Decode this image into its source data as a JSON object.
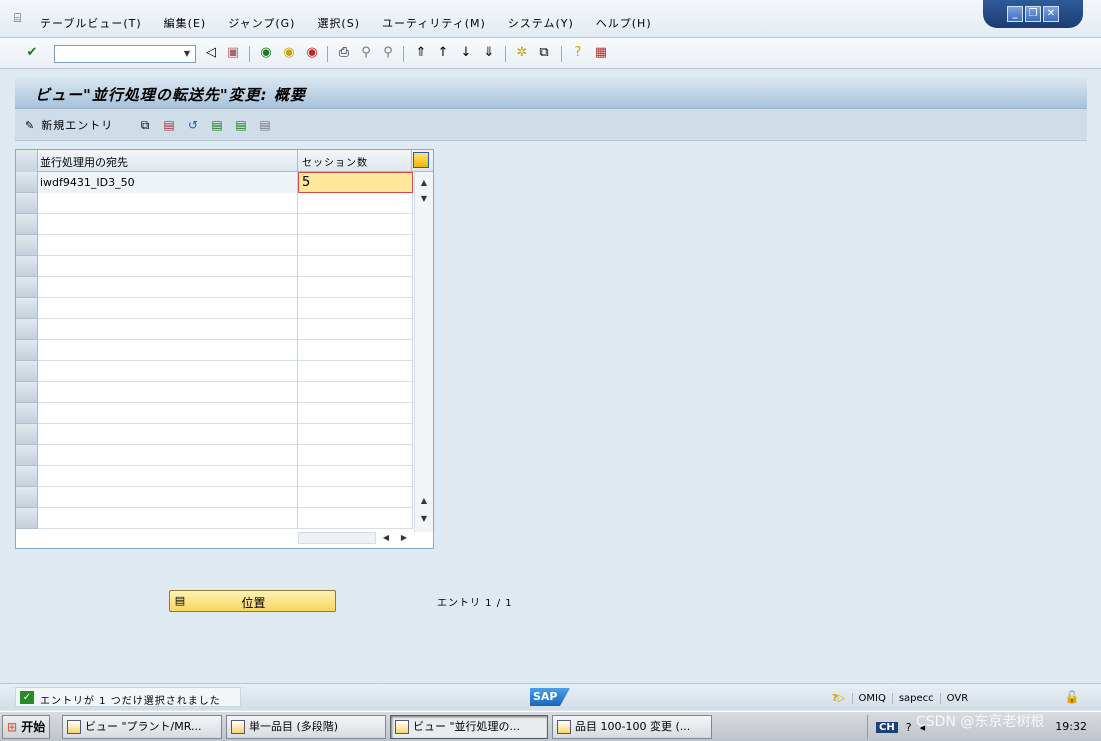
{
  "menubar": {
    "items": [
      "テーブルビュー(T)",
      "編集(E)",
      "ジャンプ(G)",
      "選択(S)",
      "ユーティリティ(M)",
      "システム(Y)",
      "ヘルプ(H)"
    ]
  },
  "window_controls": {
    "minimize": "_",
    "restore": "❐",
    "close": "✕"
  },
  "toolbar": {
    "command_value": "",
    "dropdown_glyph": "▼"
  },
  "screen": {
    "title": "ビュー\"並行処理の転送先\"変更: 概要"
  },
  "app_toolbar": {
    "new_entry_label": "新規エントリ"
  },
  "table": {
    "columns": [
      "並行処理用の宛先",
      "セッション数"
    ],
    "rows": [
      {
        "destination": "iwdf9431_ID3_50",
        "sessions": "5"
      }
    ],
    "empty_row_count": 16
  },
  "position_button": {
    "label": "位置"
  },
  "entry_count": "エントリ 1 / 1",
  "status": {
    "message": "エントリが 1 つだけ選択されました",
    "logo": "SAP",
    "transaction": "OMIQ",
    "server": "sapecc",
    "mode": "OVR"
  },
  "taskbar": {
    "start_label": "开始",
    "tasks": [
      "ビュー \"プラント/MR...",
      "単一品目 (多段階)",
      "ビュー \"並行処理の...",
      "品目 100-100 変更 (..."
    ],
    "input_lang": "CH",
    "clock": "19:32"
  },
  "watermark": "CSDN @东京老树根"
}
